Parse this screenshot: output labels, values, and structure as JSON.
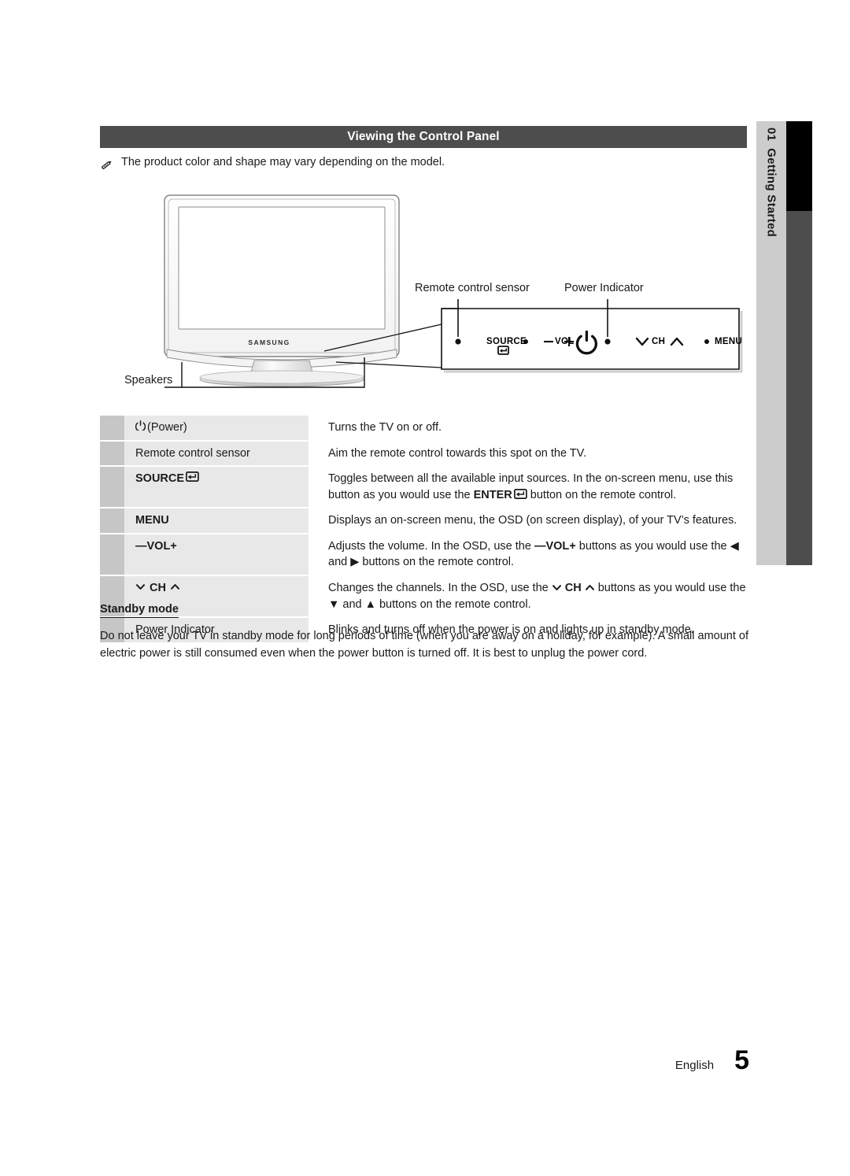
{
  "header": {
    "title": "Viewing the Control Panel"
  },
  "note": {
    "icon": "pencil-icon",
    "text": "The product color and shape may vary depending on the model."
  },
  "illustration": {
    "tv_brand_logo": "SAMSUNG",
    "labels": {
      "remote_control_sensor": "Remote control sensor",
      "power_indicator": "Power Indicator",
      "speakers": "Speakers"
    },
    "control_panel": {
      "source_label": "SOURCE",
      "source_icon": "enter-return-icon",
      "vol_minus": "—",
      "vol_label": "VOL",
      "vol_plus": "+",
      "power_icon": "power-icon",
      "ch_down_icon": "chevron-down-icon",
      "ch_label": "CH",
      "ch_up_icon": "chevron-up-icon",
      "menu_label": "MENU",
      "indicator_dots": 4
    }
  },
  "table": {
    "rows": [
      {
        "label_icon": "power-icon",
        "label": "(Power)",
        "label_bold": false,
        "description": "Turns the TV on or off."
      },
      {
        "label_icon": null,
        "label": "Remote control sensor",
        "label_bold": false,
        "description": "Aim the remote control towards this spot on the TV."
      },
      {
        "label_icon": "enter-return-icon",
        "label": "SOURCE",
        "label_bold": true,
        "description_parts": {
          "pre": "Toggles between all the available input sources. In the on-screen menu, use this button as you would use the ",
          "enter": "ENTER",
          "post": " button on the remote control."
        }
      },
      {
        "label_icon": null,
        "label": "MENU",
        "label_bold": true,
        "description": "Displays an on-screen menu, the OSD (on screen display), of your TV’s features."
      },
      {
        "label_icon": null,
        "label": "—VOL+",
        "label_bold": true,
        "description_parts": {
          "pre": "Adjusts the volume. In the OSD, use the ",
          "inline": "—VOL+",
          "post": " buttons as you would use the ◀ and ▶ buttons on the remote control."
        }
      },
      {
        "label_icon": null,
        "label": "CH",
        "label_bold": true,
        "description_parts": {
          "pre": "Changes the channels. In the OSD, use the ",
          "inline": "CH",
          "post": " buttons as you would use the ▼ and ▲ buttons on the remote control."
        }
      },
      {
        "label_icon": null,
        "label": "Power Indicator",
        "label_bold": false,
        "description": "Blinks and turns off when the power is on and lights up in standby mode."
      }
    ]
  },
  "standby": {
    "heading": "Standby mode",
    "body": "Do not leave your TV in standby mode for long periods of time (when you are away on a holiday, for example). A small amount of electric power is still consumed even when the power button is turned off. It is best to unplug the power cord."
  },
  "side_tab": {
    "number": "01",
    "text": "Getting Started"
  },
  "footer": {
    "language": "English",
    "page_number": "5"
  },
  "colors": {
    "header_bar": "#4d4d4d",
    "swatch": "#c6c6c6",
    "label_cell": "#e8e8e8",
    "tab_light": "#cccccc",
    "tab_dark": "#4d4d4d",
    "tab_black": "#000000"
  }
}
